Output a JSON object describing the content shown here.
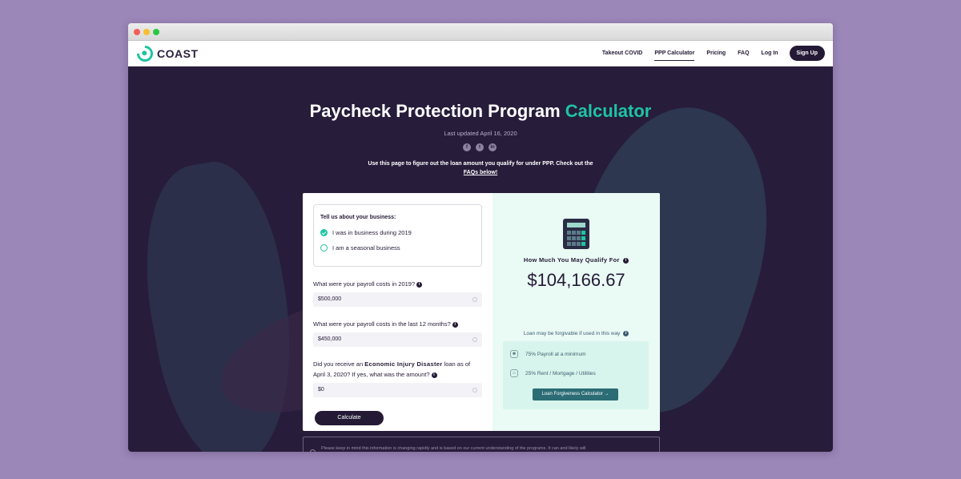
{
  "window": {
    "controls": [
      "close",
      "minimize",
      "zoom"
    ]
  },
  "nav": {
    "logo": "COAST",
    "links": [
      "Takeout COVID",
      "PPP Calculator",
      "Pricing",
      "FAQ",
      "Log In"
    ],
    "active_link": "PPP Calculator",
    "signup": "Sign Up"
  },
  "hero": {
    "title_main": "Paycheck Protection Program",
    "title_accent": "Calculator",
    "updated": "Last updated April 16, 2020",
    "social_icons": [
      "facebook-icon",
      "twitter-icon",
      "linkedin-icon"
    ],
    "intro_line1": "Use this page to figure out the loan amount you qualify for under PPP. Check out the",
    "intro_link": "FAQs below!"
  },
  "form": {
    "business_title": "Tell us about your business:",
    "options": [
      {
        "label": "I was in business during 2019",
        "checked": true
      },
      {
        "label": "I am a seasonal business",
        "checked": false
      }
    ],
    "q1": "What were your payroll costs in 2019?",
    "q1_value": "$500,000",
    "q2": "What were your payroll costs in the last 12 months?",
    "q2_value": "$450,000",
    "q3_pre": "Did you receive an",
    "q3_bold": "Economic Injury Disaster",
    "q3_post": "loan as of April 3, 2020? If yes, what was the amount?",
    "q3_value": "$0",
    "calculate": "Calculate"
  },
  "result": {
    "qualify_label": "How Much You May Qualify For",
    "amount": "$104,166.67",
    "forgive_note": "Loan may be forgivable if used in this way",
    "row1": "75% Payroll at a minimum",
    "row2": "25% Rent / Mortgage / Utilities",
    "forgiveness_button": "Loan Forgiveness Calculator →"
  },
  "disclaimer": "Please keep in mind this information is changing rapidly and is based on our current understanding of the programs. It can and likely will",
  "colors": {
    "accent": "#1ec4a3",
    "dark": "#241a35",
    "hero_bg": "#271c3a",
    "result_bg": "#eafaf5",
    "button_teal": "#2b6c75"
  }
}
